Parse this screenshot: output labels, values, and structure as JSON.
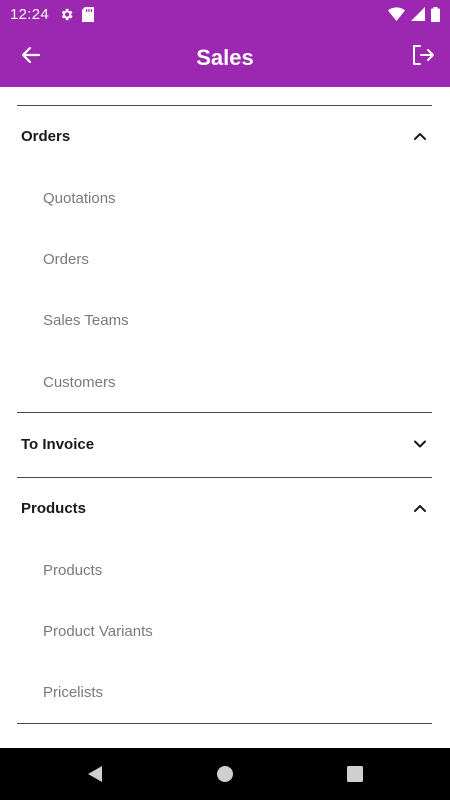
{
  "status_bar": {
    "time": "12:24",
    "icons": [
      "gear-icon",
      "sd-card-icon",
      "wifi-icon",
      "signal-icon",
      "battery-icon"
    ]
  },
  "app_bar": {
    "title": "Sales",
    "back_icon": "arrow-left-icon",
    "logout_icon": "logout-icon",
    "background": "#9c27b0"
  },
  "sections": [
    {
      "title": "Orders",
      "expanded": true,
      "items": [
        "Quotations",
        "Orders",
        "Sales Teams",
        "Customers"
      ]
    },
    {
      "title": "To Invoice",
      "expanded": false,
      "items": []
    },
    {
      "title": "Products",
      "expanded": true,
      "items": [
        "Products",
        "Product Variants",
        "Pricelists"
      ]
    }
  ],
  "nav_bar": {
    "icons": [
      "back-triangle-icon",
      "home-circle-icon",
      "recents-square-icon"
    ]
  }
}
